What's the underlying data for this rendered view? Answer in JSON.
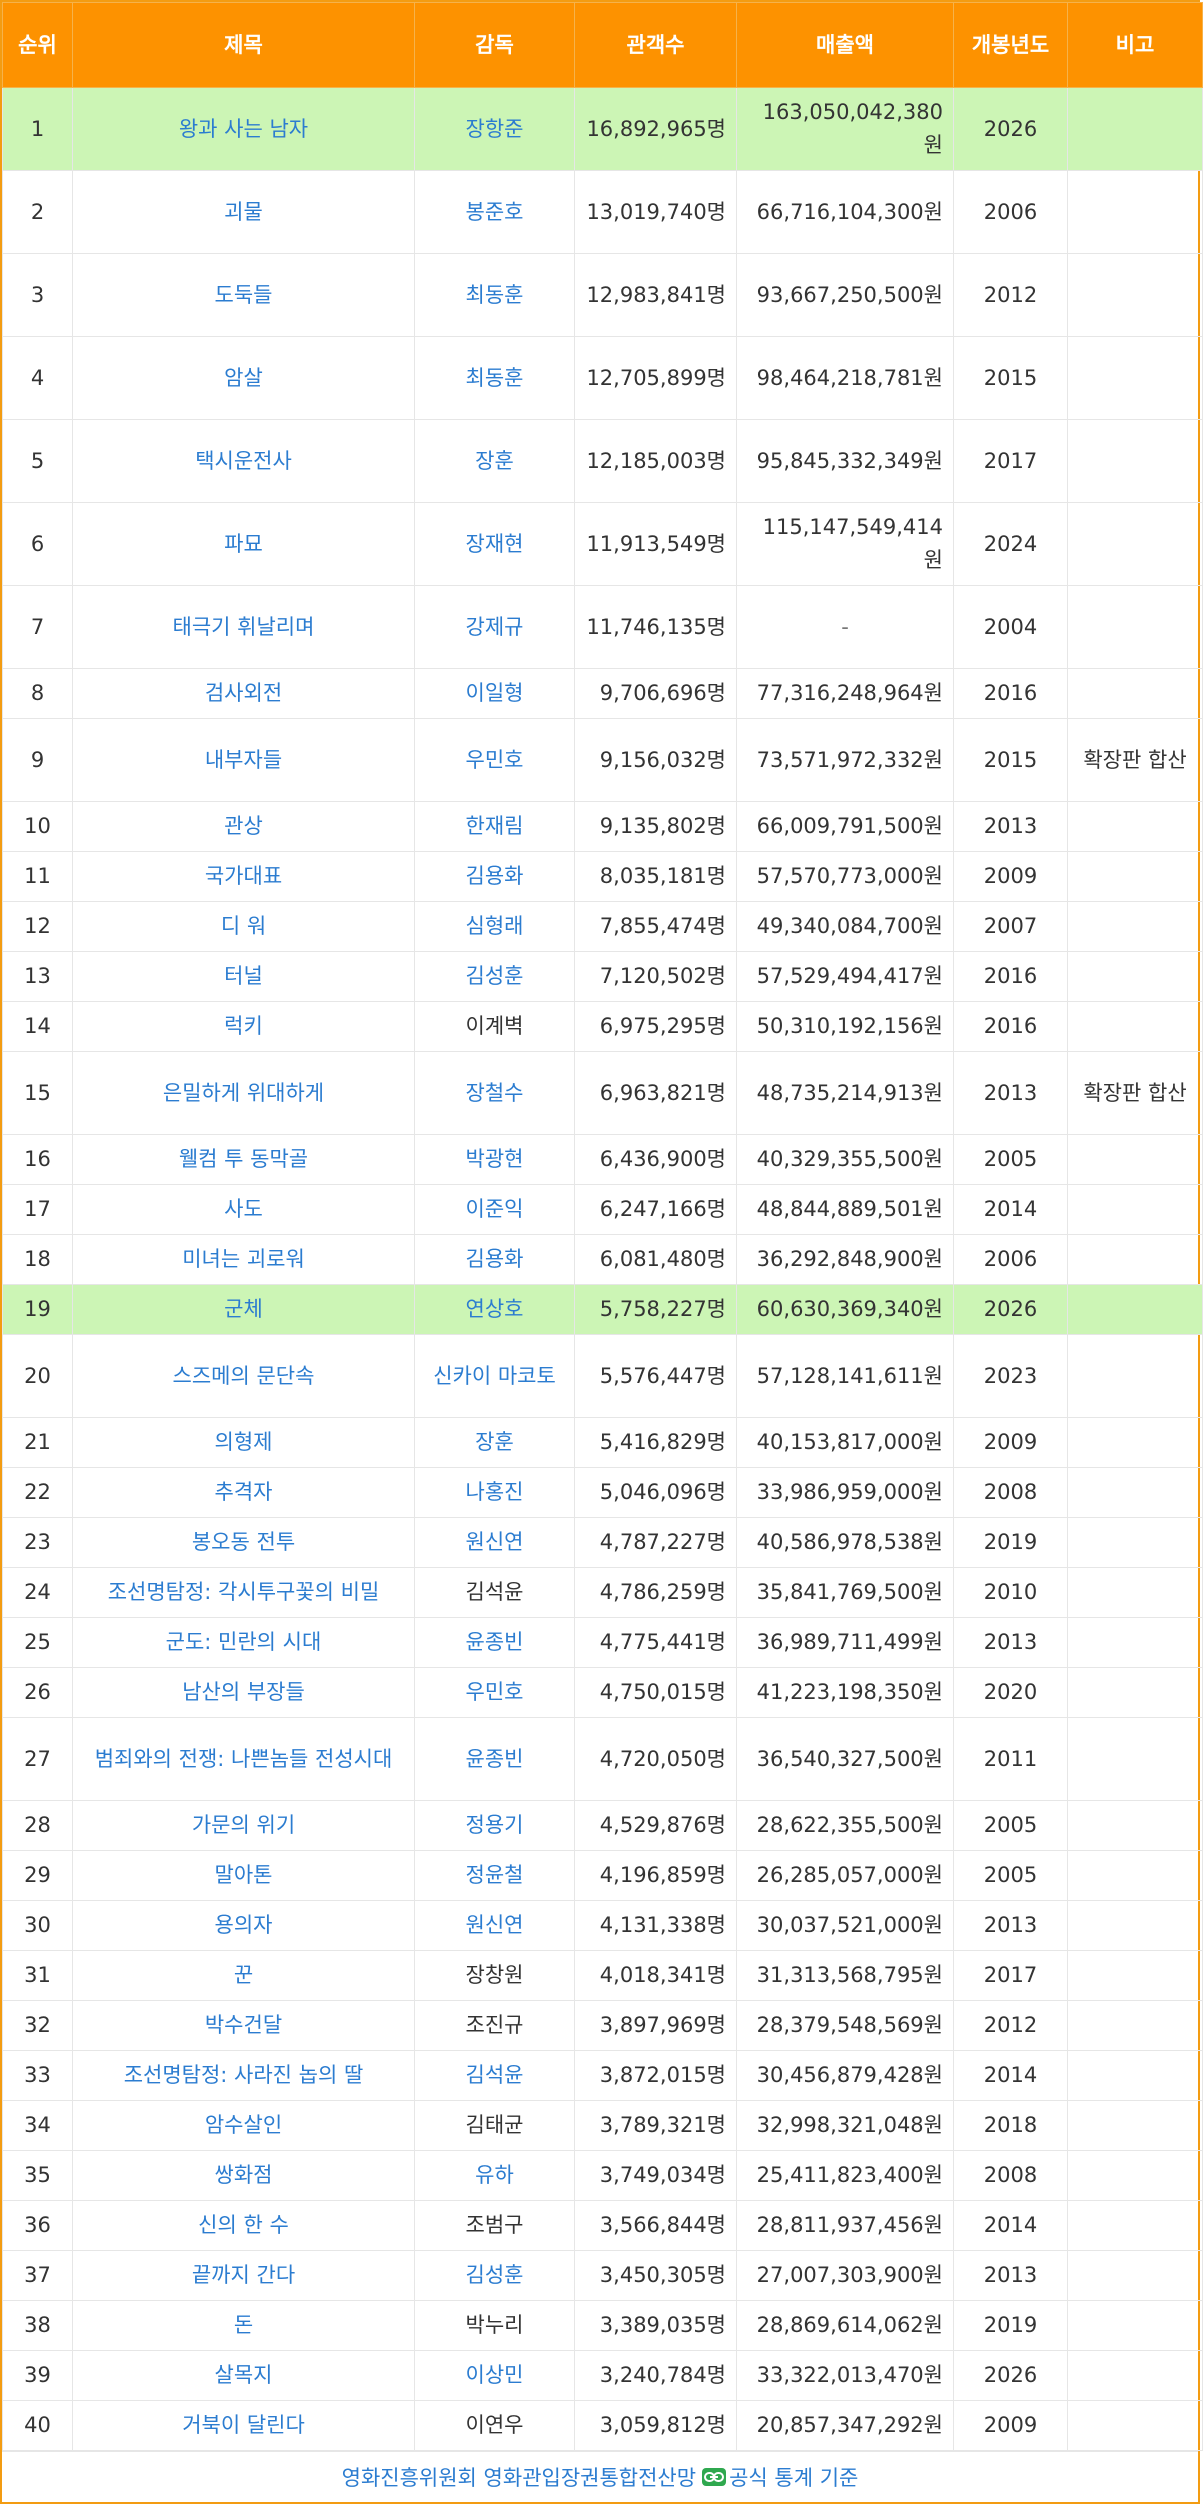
{
  "header": {
    "rank": "순위",
    "title": "제목",
    "director": "감독",
    "audience": "관객수",
    "revenue": "매출액",
    "year": "개봉년도",
    "note": "비고"
  },
  "rows": [
    {
      "rank": "1",
      "title": "왕과 사는 남자",
      "director": "장항준",
      "dir_link": true,
      "audience": "16,892,965명",
      "revenue": "163,050,042,380원",
      "year": "2026",
      "note": "",
      "hl": true
    },
    {
      "rank": "2",
      "title": "괴물",
      "director": "봉준호",
      "dir_link": true,
      "audience": "13,019,740명",
      "revenue": "66,716,104,300원",
      "year": "2006",
      "note": ""
    },
    {
      "rank": "3",
      "title": "도둑들",
      "director": "최동훈",
      "dir_link": true,
      "audience": "12,983,841명",
      "revenue": "93,667,250,500원",
      "year": "2012",
      "note": ""
    },
    {
      "rank": "4",
      "title": "암살",
      "director": "최동훈",
      "dir_link": true,
      "audience": "12,705,899명",
      "revenue": "98,464,218,781원",
      "year": "2015",
      "note": ""
    },
    {
      "rank": "5",
      "title": "택시운전사",
      "director": "장훈",
      "dir_link": true,
      "audience": "12,185,003명",
      "revenue": "95,845,332,349원",
      "year": "2017",
      "note": ""
    },
    {
      "rank": "6",
      "title": "파묘",
      "director": "장재현",
      "dir_link": true,
      "audience": "11,913,549명",
      "revenue": "115,147,549,414원",
      "year": "2024",
      "note": ""
    },
    {
      "rank": "7",
      "title": "태극기 휘날리며",
      "director": "강제규",
      "dir_link": true,
      "audience": "11,746,135명",
      "revenue": "-",
      "year": "2004",
      "note": ""
    },
    {
      "rank": "8",
      "title": "검사외전",
      "director": "이일형",
      "dir_link": true,
      "audience": "9,706,696명",
      "revenue": "77,316,248,964원",
      "year": "2016",
      "note": ""
    },
    {
      "rank": "9",
      "title": "내부자들",
      "director": "우민호",
      "dir_link": true,
      "audience": "9,156,032명",
      "revenue": "73,571,972,332원",
      "year": "2015",
      "note": "확장판 합산"
    },
    {
      "rank": "10",
      "title": "관상",
      "director": "한재림",
      "dir_link": true,
      "audience": "9,135,802명",
      "revenue": "66,009,791,500원",
      "year": "2013",
      "note": ""
    },
    {
      "rank": "11",
      "title": "국가대표",
      "director": "김용화",
      "dir_link": true,
      "audience": "8,035,181명",
      "revenue": "57,570,773,000원",
      "year": "2009",
      "note": ""
    },
    {
      "rank": "12",
      "title": "디 워",
      "director": "심형래",
      "dir_link": true,
      "audience": "7,855,474명",
      "revenue": "49,340,084,700원",
      "year": "2007",
      "note": ""
    },
    {
      "rank": "13",
      "title": "터널",
      "director": "김성훈",
      "dir_link": true,
      "audience": "7,120,502명",
      "revenue": "57,529,494,417원",
      "year": "2016",
      "note": ""
    },
    {
      "rank": "14",
      "title": "럭키",
      "director": "이계벽",
      "dir_link": false,
      "audience": "6,975,295명",
      "revenue": "50,310,192,156원",
      "year": "2016",
      "note": ""
    },
    {
      "rank": "15",
      "title": "은밀하게 위대하게",
      "director": "장철수",
      "dir_link": true,
      "audience": "6,963,821명",
      "revenue": "48,735,214,913원",
      "year": "2013",
      "note": "확장판 합산"
    },
    {
      "rank": "16",
      "title": "웰컴 투 동막골",
      "director": "박광현",
      "dir_link": true,
      "audience": "6,436,900명",
      "revenue": "40,329,355,500원",
      "year": "2005",
      "note": ""
    },
    {
      "rank": "17",
      "title": "사도",
      "director": "이준익",
      "dir_link": true,
      "audience": "6,247,166명",
      "revenue": "48,844,889,501원",
      "year": "2014",
      "note": ""
    },
    {
      "rank": "18",
      "title": "미녀는 괴로워",
      "director": "김용화",
      "dir_link": true,
      "audience": "6,081,480명",
      "revenue": "36,292,848,900원",
      "year": "2006",
      "note": ""
    },
    {
      "rank": "19",
      "title": "군체",
      "director": "연상호",
      "dir_link": true,
      "audience": "5,758,227명",
      "revenue": "60,630,369,340원",
      "year": "2026",
      "note": "",
      "hl": true
    },
    {
      "rank": "20",
      "title": "스즈메의 문단속",
      "director": "신카이 마코토",
      "dir_link": true,
      "audience": "5,576,447명",
      "revenue": "57,128,141,611원",
      "year": "2023",
      "note": ""
    },
    {
      "rank": "21",
      "title": "의형제",
      "director": "장훈",
      "dir_link": true,
      "audience": "5,416,829명",
      "revenue": "40,153,817,000원",
      "year": "2009",
      "note": ""
    },
    {
      "rank": "22",
      "title": "추격자",
      "director": "나홍진",
      "dir_link": true,
      "audience": "5,046,096명",
      "revenue": "33,986,959,000원",
      "year": "2008",
      "note": ""
    },
    {
      "rank": "23",
      "title": "봉오동 전투",
      "director": "원신연",
      "dir_link": true,
      "audience": "4,787,227명",
      "revenue": "40,586,978,538원",
      "year": "2019",
      "note": ""
    },
    {
      "rank": "24",
      "title": "조선명탐정: 각시투구꽃의 비밀",
      "director": "김석윤",
      "dir_link": false,
      "audience": "4,786,259명",
      "revenue": "35,841,769,500원",
      "year": "2010",
      "note": ""
    },
    {
      "rank": "25",
      "title": "군도: 민란의 시대",
      "director": "윤종빈",
      "dir_link": true,
      "audience": "4,775,441명",
      "revenue": "36,989,711,499원",
      "year": "2013",
      "note": ""
    },
    {
      "rank": "26",
      "title": "남산의 부장들",
      "director": "우민호",
      "dir_link": true,
      "audience": "4,750,015명",
      "revenue": "41,223,198,350원",
      "year": "2020",
      "note": ""
    },
    {
      "rank": "27",
      "title": "범죄와의 전쟁: 나쁜놈들 전성시대",
      "director": "윤종빈",
      "dir_link": true,
      "audience": "4,720,050명",
      "revenue": "36,540,327,500원",
      "year": "2011",
      "note": ""
    },
    {
      "rank": "28",
      "title": "가문의 위기",
      "director": "정용기",
      "dir_link": true,
      "audience": "4,529,876명",
      "revenue": "28,622,355,500원",
      "year": "2005",
      "note": ""
    },
    {
      "rank": "29",
      "title": "말아톤",
      "director": "정윤철",
      "dir_link": true,
      "audience": "4,196,859명",
      "revenue": "26,285,057,000원",
      "year": "2005",
      "note": ""
    },
    {
      "rank": "30",
      "title": "용의자",
      "director": "원신연",
      "dir_link": true,
      "audience": "4,131,338명",
      "revenue": "30,037,521,000원",
      "year": "2013",
      "note": ""
    },
    {
      "rank": "31",
      "title": "꾼",
      "director": "장창원",
      "dir_link": false,
      "audience": "4,018,341명",
      "revenue": "31,313,568,795원",
      "year": "2017",
      "note": ""
    },
    {
      "rank": "32",
      "title": "박수건달",
      "director": "조진규",
      "dir_link": false,
      "audience": "3,897,969명",
      "revenue": "28,379,548,569원",
      "year": "2012",
      "note": ""
    },
    {
      "rank": "33",
      "title": "조선명탐정: 사라진 놉의 딸",
      "director": "김석윤",
      "dir_link": true,
      "audience": "3,872,015명",
      "revenue": "30,456,879,428원",
      "year": "2014",
      "note": ""
    },
    {
      "rank": "34",
      "title": "암수살인",
      "director": "김태균",
      "dir_link": false,
      "audience": "3,789,321명",
      "revenue": "32,998,321,048원",
      "year": "2018",
      "note": ""
    },
    {
      "rank": "35",
      "title": "쌍화점",
      "director": "유하",
      "dir_link": true,
      "audience": "3,749,034명",
      "revenue": "25,411,823,400원",
      "year": "2008",
      "note": ""
    },
    {
      "rank": "36",
      "title": "신의 한 수",
      "director": "조범구",
      "dir_link": false,
      "audience": "3,566,844명",
      "revenue": "28,811,937,456원",
      "year": "2014",
      "note": ""
    },
    {
      "rank": "37",
      "title": "끝까지 간다",
      "director": "김성훈",
      "dir_link": true,
      "audience": "3,450,305명",
      "revenue": "27,007,303,900원",
      "year": "2013",
      "note": ""
    },
    {
      "rank": "38",
      "title": "돈",
      "director": "박누리",
      "dir_link": false,
      "audience": "3,389,035명",
      "revenue": "28,869,614,062원",
      "year": "2019",
      "note": ""
    },
    {
      "rank": "39",
      "title": "살목지",
      "director": "이상민",
      "dir_link": true,
      "audience": "3,240,784명",
      "revenue": "33,322,013,470원",
      "year": "2026",
      "note": ""
    },
    {
      "rank": "40",
      "title": "거북이 달린다",
      "director": "이연우",
      "dir_link": false,
      "audience": "3,059,812명",
      "revenue": "20,857,347,292원",
      "year": "2009",
      "note": ""
    }
  ],
  "footer": {
    "org": "영화진흥위원회 영화관입장권통합전산망",
    "icon": "link-icon",
    "link_text": "공식 통계 기준",
    "icon_color": "#2fa84f"
  },
  "colors": {
    "header_bg": "#fd9200",
    "highlight_bg": "#ccf5b5",
    "link": "#2b7cd0"
  }
}
